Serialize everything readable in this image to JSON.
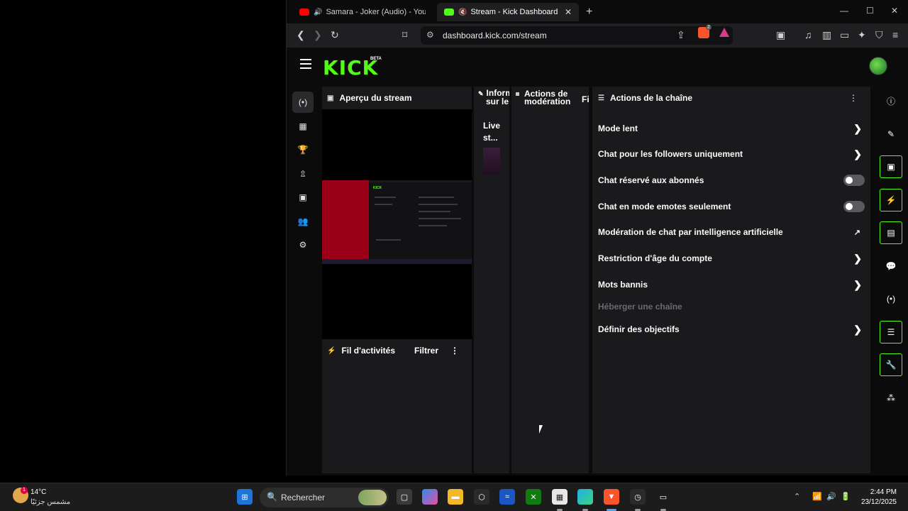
{
  "browser": {
    "tabs": [
      {
        "label": "Samara - Joker (Audio) - YouTube",
        "favicon": "youtube-icon",
        "color": "#ff0000"
      },
      {
        "label": "Stream - Kick Dashboard",
        "favicon": "kick-icon",
        "color": "#53fc18",
        "close": "✕"
      }
    ],
    "new_tab": "+",
    "url": "dashboard.kick.com/stream",
    "shield_count": "2"
  },
  "kick": {
    "logo": "KICK",
    "beta": "BETA",
    "left_nav": [
      "stream-icon",
      "analytics-icon",
      "trophy-icon",
      "upload-icon",
      "capture-icon",
      "users-icon",
      "settings-icon"
    ],
    "preview_title": "Aperçu du stream",
    "activity_title": "Fil d'activités",
    "activity_filter": "Filtrer",
    "info_title_line1": "Inform",
    "info_title_line2": "sur le",
    "info_live_line1": "Live",
    "info_live_line2": "st...",
    "mod_title_line1": "Actions de",
    "mod_title_line2": "modération",
    "mod_fil": "Fil",
    "actions_title": "Actions de la chaîne",
    "actions": [
      {
        "label": "Mode lent",
        "control": "chevron"
      },
      {
        "label": "Chat pour les followers uniquement",
        "control": "chevron"
      },
      {
        "label": "Chat réservé aux abonnés",
        "control": "toggle"
      },
      {
        "label": "Chat en mode emotes seulement",
        "control": "toggle"
      },
      {
        "label": "Modération de chat par intelligence artificielle",
        "control": "external"
      },
      {
        "label": "Restriction d'âge du compte",
        "control": "chevron"
      },
      {
        "label": "Mots bannis",
        "control": "chevron"
      },
      {
        "label": "Héberger une chaîne",
        "control": "none"
      },
      {
        "label": "Définir des objectifs",
        "control": "chevron"
      }
    ],
    "brand_color": "#53fc18"
  },
  "taskbar": {
    "temp": "14°C",
    "condition": "مشمس جزئيًا",
    "weather_badge": "1",
    "search": "Rechercher",
    "time": "2:44 PM",
    "date": "23/12/2025"
  }
}
